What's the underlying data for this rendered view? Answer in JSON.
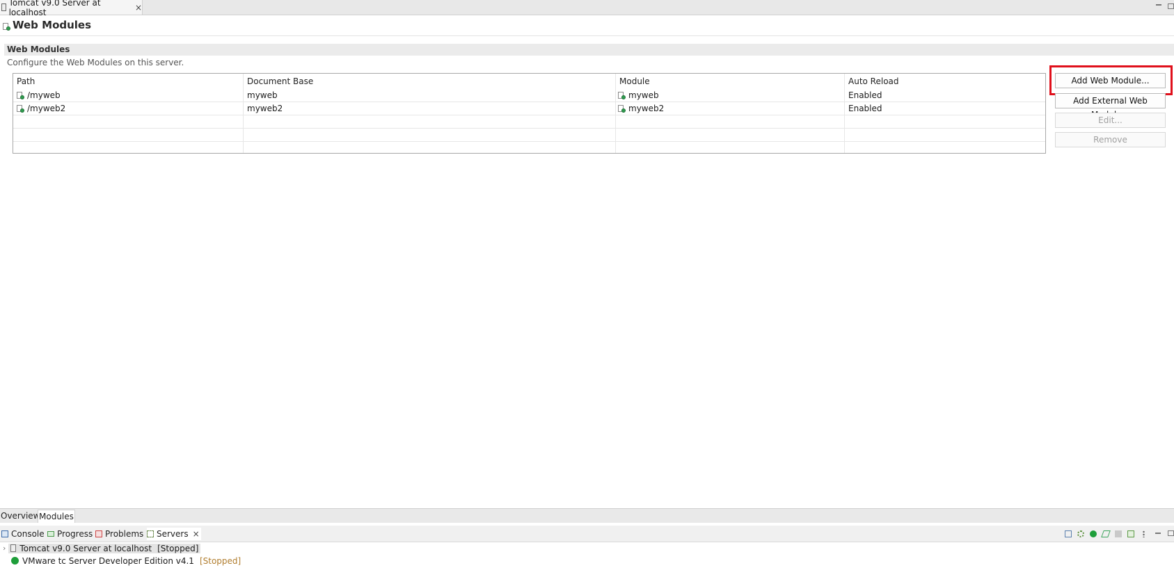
{
  "editor": {
    "tab_title": "Tomcat v9.0 Server at localhost",
    "tab_close": "×"
  },
  "page": {
    "title": "Web Modules"
  },
  "section": {
    "title": "Web Modules",
    "description": "Configure the Web Modules on this server."
  },
  "table": {
    "columns": [
      "Path",
      "Document Base",
      "Module",
      "Auto Reload"
    ],
    "rows": [
      {
        "path": "/myweb",
        "document_base": "myweb",
        "module": "myweb",
        "auto_reload": "Enabled"
      },
      {
        "path": "/myweb2",
        "document_base": "myweb2",
        "module": "myweb2",
        "auto_reload": "Enabled"
      }
    ]
  },
  "buttons": {
    "add_web_module": "Add Web Module...",
    "add_external_web_module": "Add External Web Module...",
    "edit": "Edit...",
    "remove": "Remove"
  },
  "page_tabs": [
    "Overview",
    "Modules"
  ],
  "views": {
    "tabs": [
      "Console",
      "Progress",
      "Problems",
      "Servers"
    ],
    "close": "×"
  },
  "servers": [
    {
      "name": "Tomcat v9.0 Server at localhost",
      "status": "[Stopped]"
    },
    {
      "name": "VMware tc Server Developer Edition v4.1",
      "status": "[Stopped]"
    }
  ],
  "colors": {
    "highlight": "#e0101b",
    "status_text": "#b07c2c",
    "start_icon": "#1e9e3a"
  }
}
